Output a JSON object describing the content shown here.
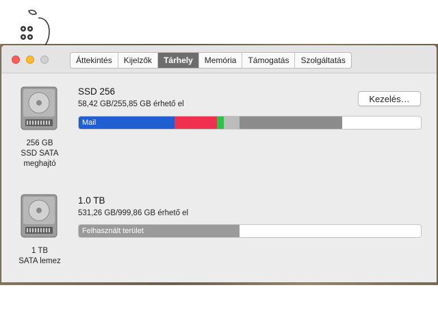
{
  "tabs": [
    {
      "label": "Áttekintés"
    },
    {
      "label": "Kijelzők"
    },
    {
      "label": "Tárhely"
    },
    {
      "label": "Memória"
    },
    {
      "label": "Támogatás"
    },
    {
      "label": "Szolgáltatás"
    }
  ],
  "active_tab": "Tárhely",
  "drives": [
    {
      "caption_line1": "256 GB",
      "caption_line2": "SSD SATA",
      "caption_line3": "meghajtó",
      "name": "SSD 256",
      "available": "58,42 GB/255,85 GB érhető el",
      "manage_label": "Kezelés…",
      "usage_segments": [
        {
          "label": "Mail",
          "fraction": 0.28,
          "color": "#1f5fd1"
        },
        {
          "label": "",
          "fraction": 0.124,
          "color": "#f0304f"
        },
        {
          "label": "",
          "fraction": 0.02,
          "color": "#2bc24a"
        },
        {
          "label": "",
          "fraction": 0.046,
          "color": "#bcbcbc"
        },
        {
          "label": "",
          "fraction": 0.3,
          "color": "#8c8c8c"
        }
      ]
    },
    {
      "caption_line1": "1 TB",
      "caption_line2": "SATA lemez",
      "name": "1.0 TB",
      "available": "531,26 GB/999,86 GB érhető el",
      "usage_segments": [
        {
          "label": "Felhasznált terület",
          "fraction": 0.469,
          "color": "#9a9a9a"
        }
      ]
    }
  ]
}
